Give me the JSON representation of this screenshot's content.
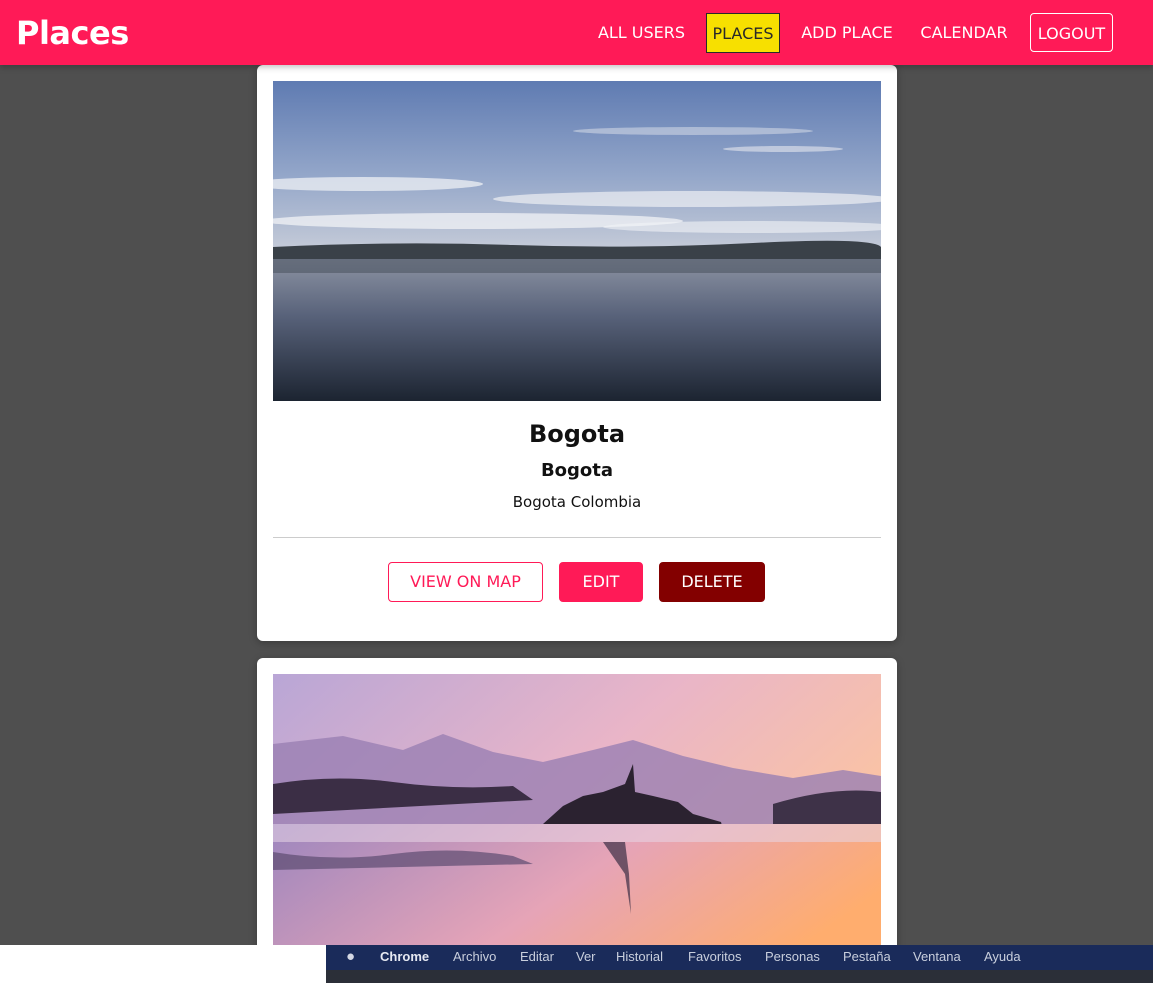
{
  "header": {
    "brand": "Places",
    "nav": {
      "all_users": "ALL USERS",
      "places": "PLACES",
      "add_place": "ADD PLACE",
      "calendar": "CALENDAR",
      "logout": "LOGOUT"
    }
  },
  "places": [
    {
      "title": "Bogota",
      "address": "Bogota",
      "description": "Bogota Colombia",
      "buttons": {
        "view_on_map": "VIEW ON MAP",
        "edit": "EDIT",
        "delete": "DELETE"
      }
    }
  ],
  "menubar": {
    "app": "Chrome",
    "items": [
      "Archivo",
      "Editar",
      "Ver",
      "Historial",
      "Favoritos",
      "Personas",
      "Pestaña",
      "Ventana",
      "Ayuda"
    ]
  },
  "colors": {
    "accent": "#ff1a57",
    "active_nav": "#f7e000",
    "delete": "#830000",
    "page_background": "#4f4f4f"
  }
}
